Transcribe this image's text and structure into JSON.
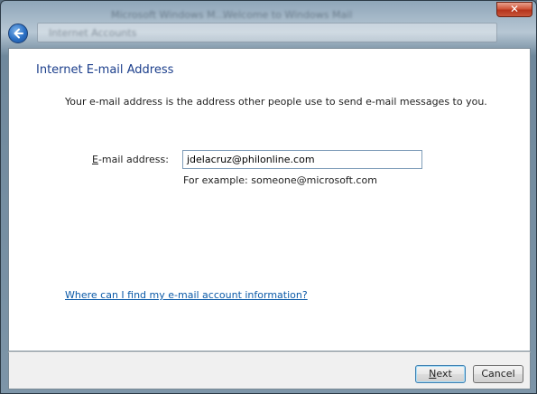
{
  "background": {
    "window_title_1": "Microsoft Windows M...",
    "window_title_2": "Welcome to Windows Mail",
    "addressbar_text": "Internet Accounts"
  },
  "window": {
    "close_glyph": "✕"
  },
  "wizard": {
    "title": "Internet E-mail Address",
    "description": "Your e-mail address is the address other people use to send e-mail messages to you.",
    "email_label_accel": "E",
    "email_label_rest": "-mail address:",
    "email_value": "jdelacruz@philonline.com",
    "example": "For example: someone@microsoft.com",
    "help_link": "Where can I find my e-mail account information?"
  },
  "buttons": {
    "next_accel": "N",
    "next_rest": "ext",
    "cancel": "Cancel"
  },
  "colors": {
    "title": "#1c3f8c",
    "link": "#0b5aa8"
  }
}
